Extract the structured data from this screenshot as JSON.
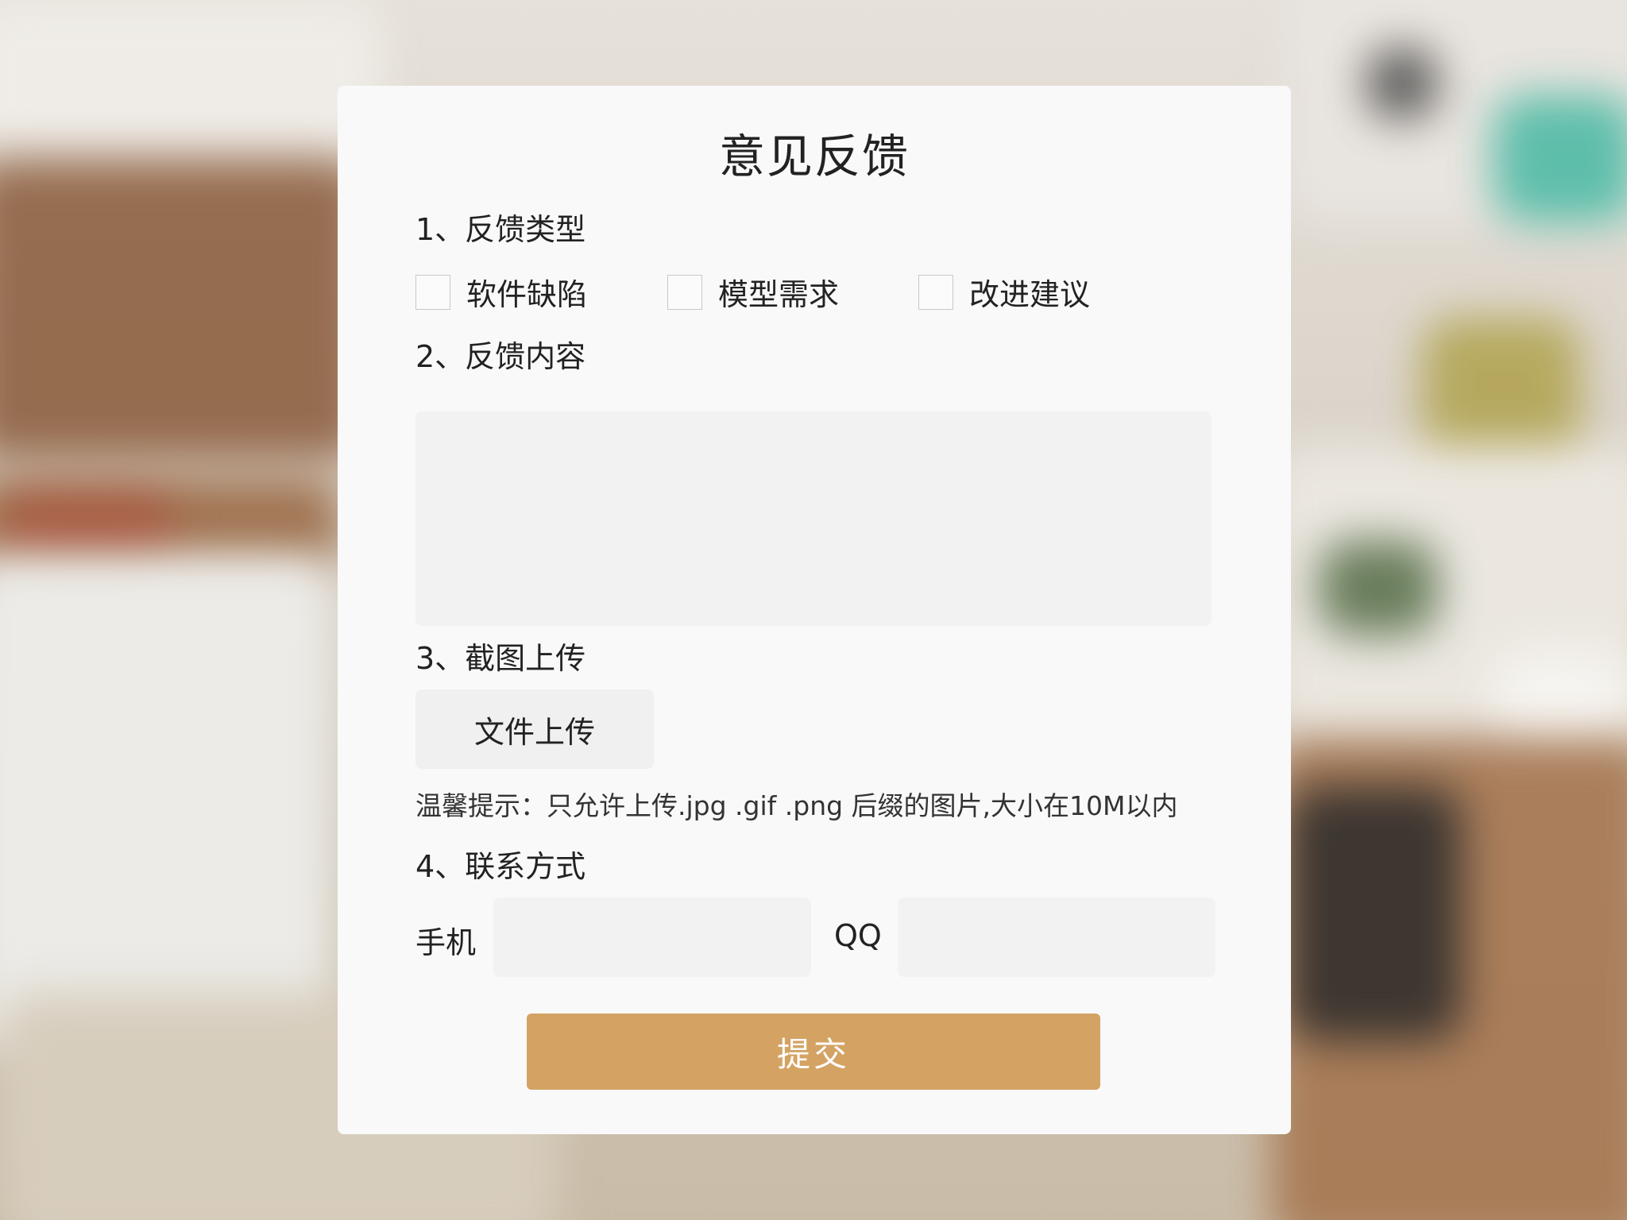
{
  "form": {
    "title": "意见反馈",
    "section1_label": "1、反馈类型",
    "feedback_types": [
      "软件缺陷",
      "模型需求",
      "改进建议"
    ],
    "section2_label": "2、反馈内容",
    "content_value": "",
    "section3_label": "3、截图上传",
    "upload_button_label": "文件上传",
    "upload_hint": "温馨提示：只允许上传.jpg .gif .png 后缀的图片,大小在10M以内",
    "section4_label": "4、联系方式",
    "phone_label": "手机",
    "phone_value": "",
    "qq_label": "QQ",
    "qq_value": "",
    "submit_label": "提交"
  },
  "colors": {
    "accent": "#d4a364",
    "panel_bg": "#f9f9f9",
    "input_bg": "#f2f2f2"
  }
}
